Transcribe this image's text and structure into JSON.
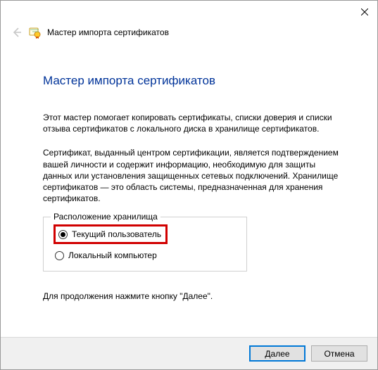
{
  "titlebar": {
    "close_tooltip": "Закрыть"
  },
  "header": {
    "back_label": "Назад",
    "wizard_name": "Мастер импорта сертификатов"
  },
  "main": {
    "heading": "Мастер импорта сертификатов",
    "intro": "Этот мастер помогает копировать сертификаты, списки доверия и списки отзыва сертификатов с локального диска в хранилище сертификатов.",
    "explain": "Сертификат, выданный центром сертификации, является подтверждением вашей личности и содержит информацию, необходимую для защиты данных или установления защищенных сетевых подключений. Хранилище сертификатов — это область системы, предназначенная для хранения сертификатов.",
    "store_location": {
      "legend": "Расположение хранилища",
      "options": [
        {
          "label": "Текущий пользователь",
          "selected": true
        },
        {
          "label": "Локальный компьютер",
          "selected": false
        }
      ]
    },
    "continue_hint": "Для продолжения нажмите кнопку \"Далее\"."
  },
  "buttons": {
    "next": "Далее",
    "cancel": "Отмена"
  }
}
